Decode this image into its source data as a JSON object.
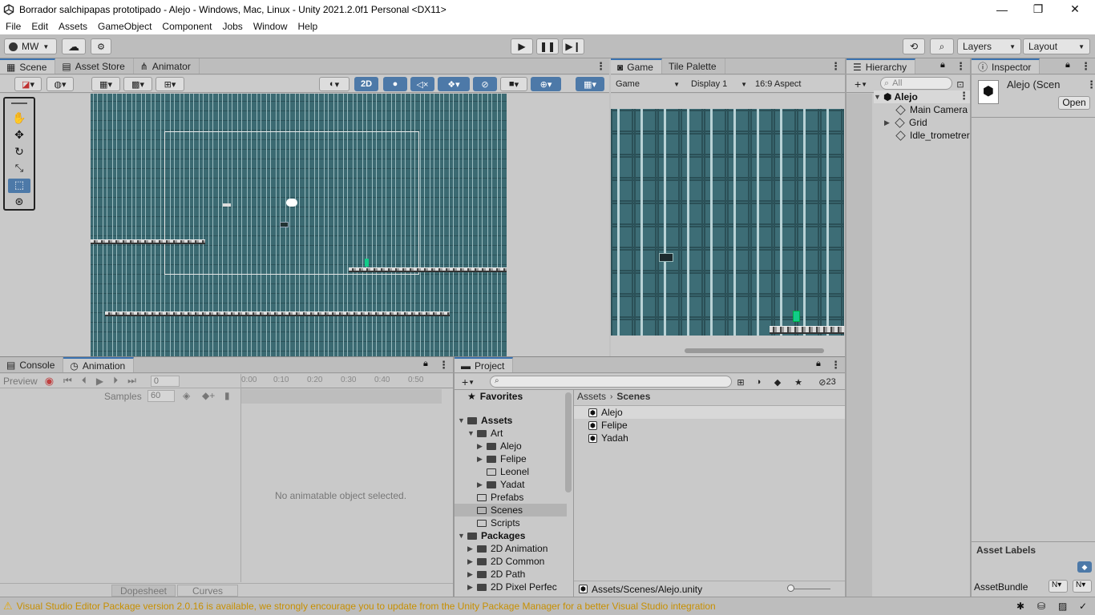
{
  "window": {
    "title": "Borrador salchipapas prototipado - Alejo - Windows, Mac, Linux - Unity 2021.2.0f1 Personal <DX11>",
    "minimize": "—",
    "maximize": "❐",
    "close": "✕"
  },
  "menu": [
    "File",
    "Edit",
    "Assets",
    "GameObject",
    "Component",
    "Jobs",
    "Window",
    "Help"
  ],
  "toolbar": {
    "account": "MW",
    "layers": "Layers",
    "layout": "Layout"
  },
  "scene_tabs": [
    "Scene",
    "Asset Store",
    "Animator"
  ],
  "scene_toolbar": {
    "mode_2d": "2D"
  },
  "game_tabs": [
    "Game",
    "Tile Palette"
  ],
  "game_toolbar": {
    "view": "Game",
    "display": "Display 1",
    "aspect": "16:9 Aspect"
  },
  "hierarchy": {
    "tab": "Hierarchy",
    "search_placeholder": "All",
    "scene": "Alejo",
    "items": [
      "Main Camera",
      "Grid",
      "Idle_trometrer"
    ]
  },
  "inspector": {
    "tab": "Inspector",
    "name": "Alejo (Scen",
    "open": "Open",
    "asset_labels": "Asset Labels",
    "asset_bundle": "AssetBundle",
    "bundle_value": "N"
  },
  "bottom_left_tabs": [
    "Console",
    "Animation"
  ],
  "animation": {
    "preview": "Preview",
    "frame": "0",
    "samples_label": "Samples",
    "samples": "60",
    "ticks": [
      "0:00",
      "0:10",
      "0:20",
      "0:30",
      "0:40",
      "0:50"
    ],
    "empty": "No animatable object selected.",
    "dopesheet": "Dopesheet",
    "curves": "Curves"
  },
  "project": {
    "tab": "Project",
    "hidden_count": "23",
    "breadcrumb": [
      "Assets",
      "Scenes"
    ],
    "tree": [
      {
        "label": "Favorites",
        "indent": 0,
        "bold": true,
        "kind": "star"
      },
      {
        "label": "Assets",
        "indent": 0,
        "bold": true,
        "kind": "folder",
        "open": true
      },
      {
        "label": "Art",
        "indent": 1,
        "kind": "folder",
        "open": true
      },
      {
        "label": "Alejo",
        "indent": 2,
        "kind": "folder",
        "arrow": true
      },
      {
        "label": "Felipe",
        "indent": 2,
        "kind": "folder",
        "arrow": true
      },
      {
        "label": "Leonel",
        "indent": 2,
        "kind": "folder-empty"
      },
      {
        "label": "Yadat",
        "indent": 2,
        "kind": "folder",
        "arrow": true
      },
      {
        "label": "Prefabs",
        "indent": 1,
        "kind": "folder-empty"
      },
      {
        "label": "Scenes",
        "indent": 1,
        "kind": "folder-empty",
        "selected": true
      },
      {
        "label": "Scripts",
        "indent": 1,
        "kind": "folder-empty"
      },
      {
        "label": "Packages",
        "indent": 0,
        "bold": true,
        "kind": "folder",
        "open": true
      },
      {
        "label": "2D Animation",
        "indent": 1,
        "kind": "folder",
        "arrow": true
      },
      {
        "label": "2D Common",
        "indent": 1,
        "kind": "folder",
        "arrow": true
      },
      {
        "label": "2D Path",
        "indent": 1,
        "kind": "folder",
        "arrow": true
      },
      {
        "label": "2D Pixel Perfec",
        "indent": 1,
        "kind": "folder",
        "arrow": true
      }
    ],
    "files": [
      "Alejo",
      "Felipe",
      "Yadah"
    ],
    "footer_path": "Assets/Scenes/Alejo.unity"
  },
  "status": {
    "message": "Visual Studio Editor Package version 2.0.16 is available, we strongly encourage you to update from the Unity Package Manager for a better Visual Studio integration",
    "color": "#e6a800"
  }
}
